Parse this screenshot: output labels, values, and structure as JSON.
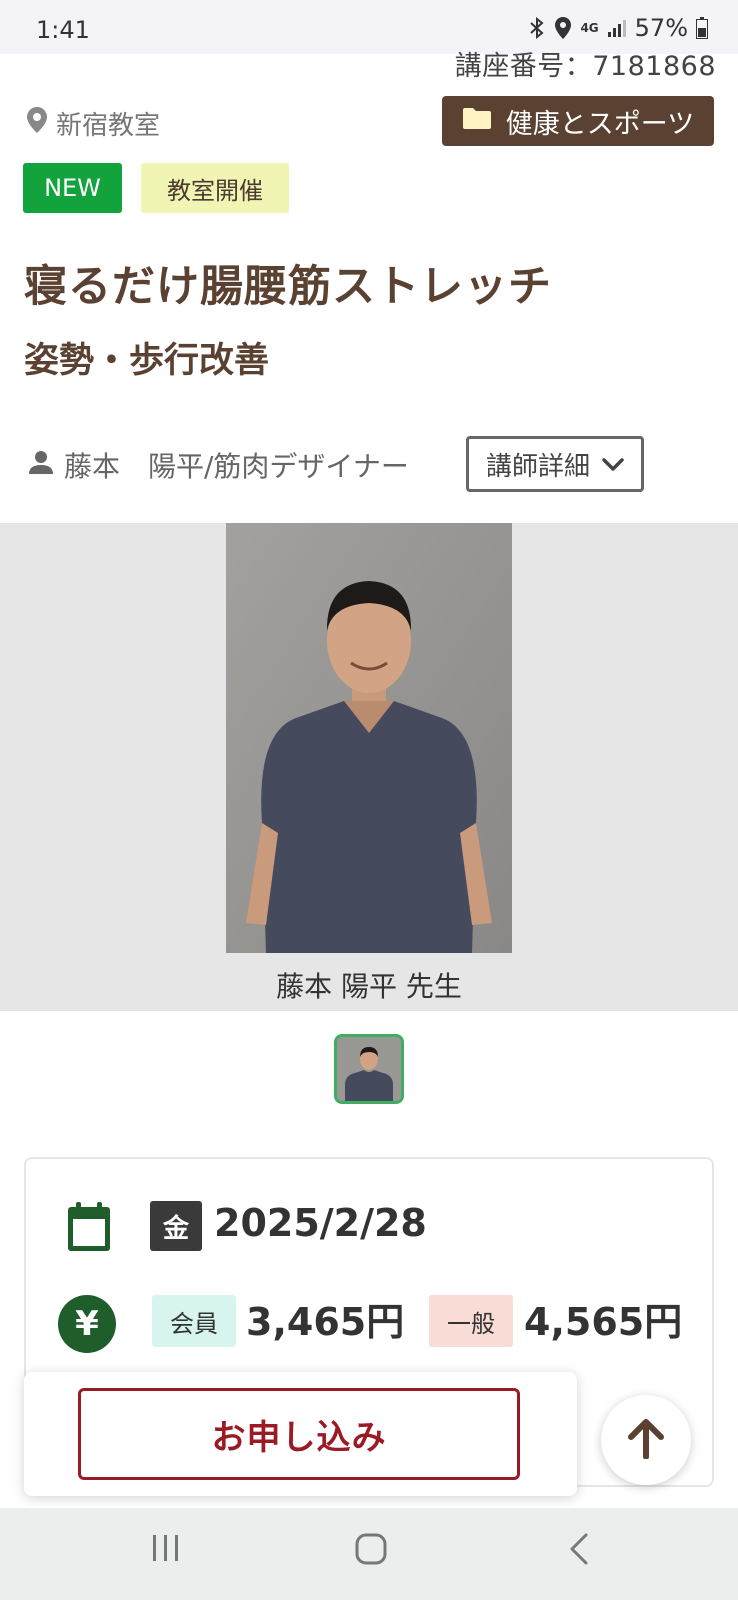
{
  "status_bar": {
    "time": "1:41",
    "network": "4G",
    "battery": "57%"
  },
  "course": {
    "number_label": "講座番号：7181868",
    "location": "新宿教室",
    "category": "健康とスポーツ",
    "tags": [
      "NEW",
      "教室開催"
    ],
    "title": "寝るだけ腸腰筋ストレッチ",
    "subtitle": "姿勢・歩行改善"
  },
  "instructor": {
    "name": "藤本　陽平/筋肉デザイナー",
    "detail_button": "講師詳細",
    "photo_caption": "藤本 陽平 先生"
  },
  "schedule": {
    "weekday": "金",
    "date": "2025/2/28"
  },
  "pricing": {
    "member_label": "会員",
    "member_price": "3,465円",
    "general_label": "一般",
    "general_price": "4,565円",
    "currency_symbol": "¥"
  },
  "actions": {
    "apply_label": "お申し込み"
  },
  "colors": {
    "brand_brown": "#5a4131",
    "new_green": "#12a33c",
    "apply_red": "#9b1b25",
    "dark_green": "#1f5e2a"
  }
}
